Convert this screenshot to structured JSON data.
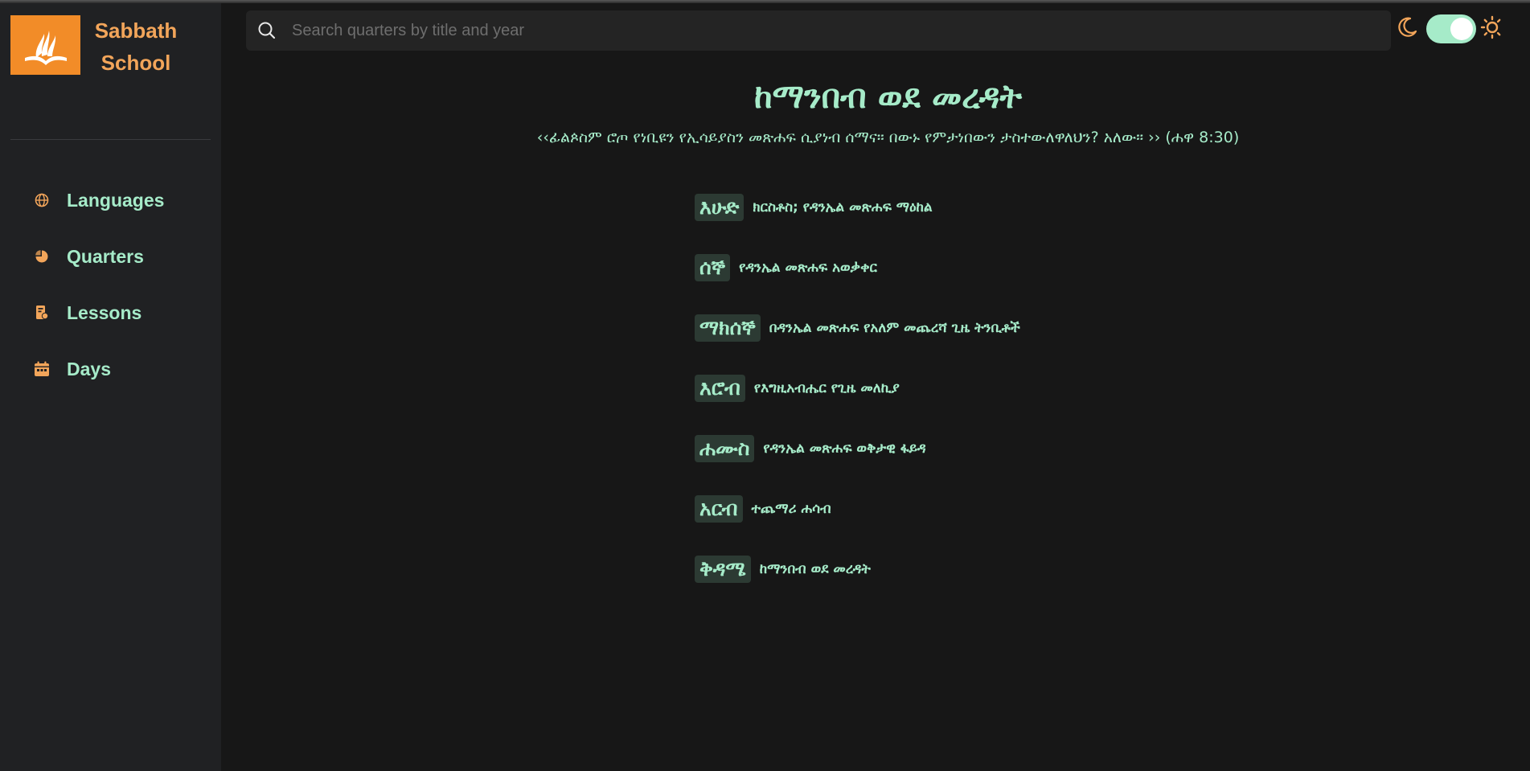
{
  "brand": {
    "line1": "Sabbath",
    "line2": "School",
    "logo_icon": "adventist-flame-bible-icon",
    "accent": "#f28c28"
  },
  "sidebar": {
    "items": [
      {
        "label": "Languages",
        "icon": "globe-icon"
      },
      {
        "label": "Quarters",
        "icon": "pie-chart-icon"
      },
      {
        "label": "Lessons",
        "icon": "lesson-book-icon"
      },
      {
        "label": "Days",
        "icon": "calendar-icon"
      }
    ]
  },
  "search": {
    "placeholder": "Search quarters by title and year",
    "value": ""
  },
  "theme": {
    "mode": "dark",
    "moon_icon": "moon-icon",
    "sun_icon": "sun-icon",
    "toggle_on": true
  },
  "lesson": {
    "title": "ከማንበብ ወደ መረዳት",
    "memory_verse": "‹‹ፊልጶስም ሮጦ የነቢዩን የኢሳይያስን መጽሐፍ ሲያነብ ሰማና። በውኑ የምታነበውን ታስተውለዋለህን? አለው። ›› (ሐዋ 8:30)"
  },
  "days": [
    {
      "name": "እሁድ",
      "title": "ክርስቶስ; የዳንኤል መጽሐፍ ማዕከል"
    },
    {
      "name": "ሰኞ",
      "title": "የዳንኤል መጽሐፍ አወቃቀር"
    },
    {
      "name": "ማክሰኞ",
      "title": "በዳንኤል መጽሐፍ የአለም መጨረሻ ጊዜ ትንቢቶች"
    },
    {
      "name": "እሮብ",
      "title": "የእግዚአብሔር የጊዜ መለኪያ"
    },
    {
      "name": "ሐሙስ",
      "title": "የዳንኤል መጽሐፍ ወቅታዊ ፋይዳ"
    },
    {
      "name": "አርብ",
      "title": "ተጨማሪ ሐሳብ"
    },
    {
      "name": "ቅዳሜ",
      "title": "ከማንበብ ወደ መረዳት"
    }
  ],
  "colors": {
    "text": "#a6ebc9",
    "orange": "#f2a55a",
    "sidebar_bg": "#202123",
    "main_bg": "#171717"
  }
}
